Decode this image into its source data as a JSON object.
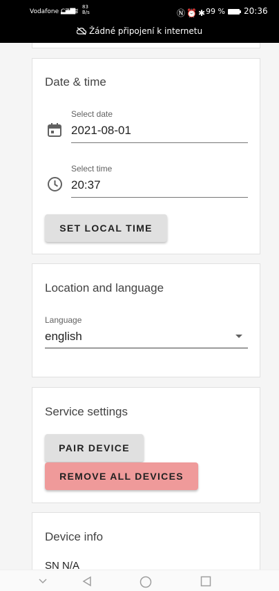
{
  "status_bar": {
    "carrier": "Vodafone CZ",
    "net_speed_value": "83",
    "net_speed_unit": "B/s",
    "battery_text": "99 %",
    "clock": "20:36",
    "offline_message": "Žádné připojení k internetu"
  },
  "date_time": {
    "title": "Date & time",
    "date_label": "Select date",
    "date_value": "2021-08-01",
    "time_label": "Select time",
    "time_value": "20:37",
    "set_local_time_label": "SET LOCAL TIME"
  },
  "location": {
    "title": "Location and language",
    "language_label": "Language",
    "language_value": "english"
  },
  "service": {
    "title": "Service settings",
    "pair_label": "PAIR DEVICE",
    "remove_label": "REMOVE ALL DEVICES"
  },
  "device_info": {
    "title": "Device info",
    "sn_text": "SN N/A"
  },
  "colors": {
    "danger_button": "#ef9a9a",
    "neutral_button": "#e0e0e0",
    "page_background": "#f5f5f5"
  },
  "icons": [
    "calendar-icon",
    "clock-icon",
    "dropdown-arrow-icon",
    "back-icon",
    "home-icon",
    "recents-icon"
  ]
}
